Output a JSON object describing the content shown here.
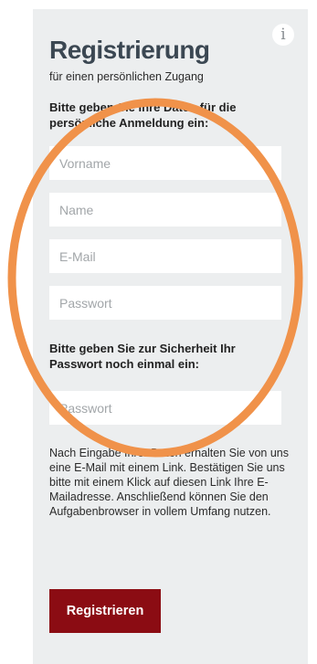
{
  "form": {
    "info_icon_glyph": "i",
    "title": "Registrierung",
    "subtitle": "für einen persönlichen Zugang",
    "instruction_1": "Bitte geben Sie Ihre Daten für die persönliche Anmeldung ein:",
    "fields": [
      {
        "placeholder": "Vorname",
        "value": ""
      },
      {
        "placeholder": "Name",
        "value": ""
      },
      {
        "placeholder": "E-Mail",
        "value": ""
      },
      {
        "placeholder": "Passwort",
        "value": ""
      }
    ],
    "instruction_2": "Bitte geben Sie zur Sicherheit Ihr Passwort noch einmal ein:",
    "confirm_field": {
      "placeholder": "Passwort",
      "value": ""
    },
    "note": "Nach Eingabe Ihrer Daten erhalten Sie von uns eine E-Mail mit einem Link. Bestätigen Sie uns bitte mit einem Klick auf diesen Link Ihre E-Mailadresse. Anschließend können Sie den Aufgabenbrowser in vollem Umfang nutzen.",
    "submit_label": "Registrieren"
  },
  "colors": {
    "panel_background": "#eceeef",
    "title": "#3b4752",
    "button_background": "#8b0c13",
    "highlight_ring": "#f0924a"
  },
  "icons": {
    "info": "info-icon"
  }
}
